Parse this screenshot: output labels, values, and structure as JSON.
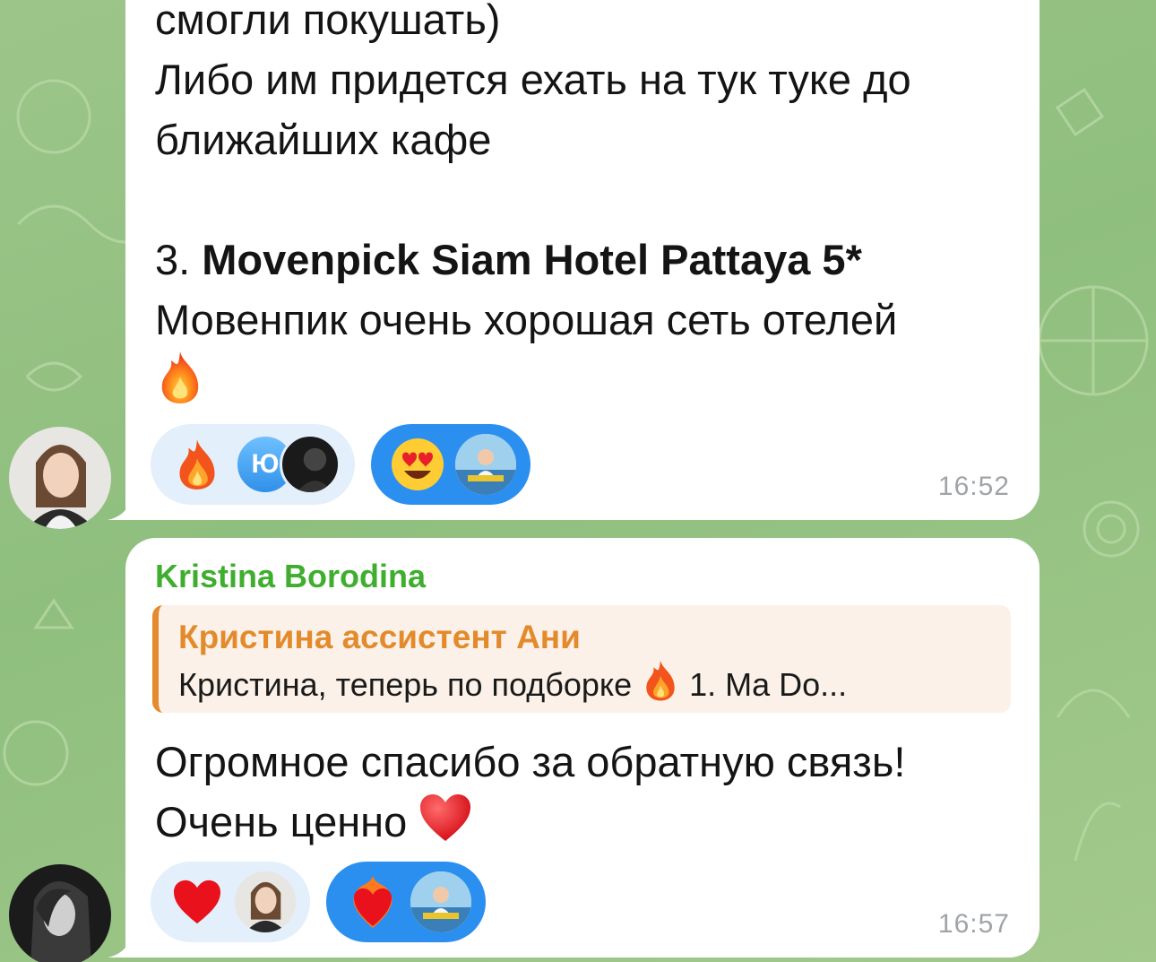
{
  "messages": [
    {
      "lines_top": "смогли покушать)\nЛибо им придется ехать на тук туке до\nближайших кафе\n\n",
      "item_prefix": "3. ",
      "item_title": "Movenpick Siam Hotel Pattaya 5*",
      "line_after": "Мовенпик очень хорошая сеть отелей",
      "time": "16:52",
      "reactions": [
        {
          "emoji": "fire-icon",
          "avatars": [
            "Ю",
            "dark-avatar"
          ]
        },
        {
          "emoji": "heart-eyes-icon",
          "avatars": [
            "channel-avatar"
          ]
        }
      ]
    },
    {
      "author": "Kristina Borodina",
      "reply": {
        "name": "Кристина ассистент Ани",
        "text_before": "Кристина, теперь по подборке ",
        "text_after": " 1. Ma Do..."
      },
      "line1": "Огромное спасибо за обратную связь!",
      "line2": "Очень ценно ",
      "time": "16:57",
      "reactions": [
        {
          "emoji": "heart-icon",
          "avatars": [
            "user-avatar"
          ]
        },
        {
          "emoji": "heart-on-fire-icon",
          "avatars": [
            "channel-avatar"
          ]
        }
      ]
    }
  ],
  "avatar_initial": "Ю",
  "colors": {
    "author": "#3fae2f",
    "reply_accent": "#e38b2c",
    "reaction_active": "#2b8ff0",
    "reaction_inactive": "#e3effb",
    "time": "#a0a4a8"
  }
}
